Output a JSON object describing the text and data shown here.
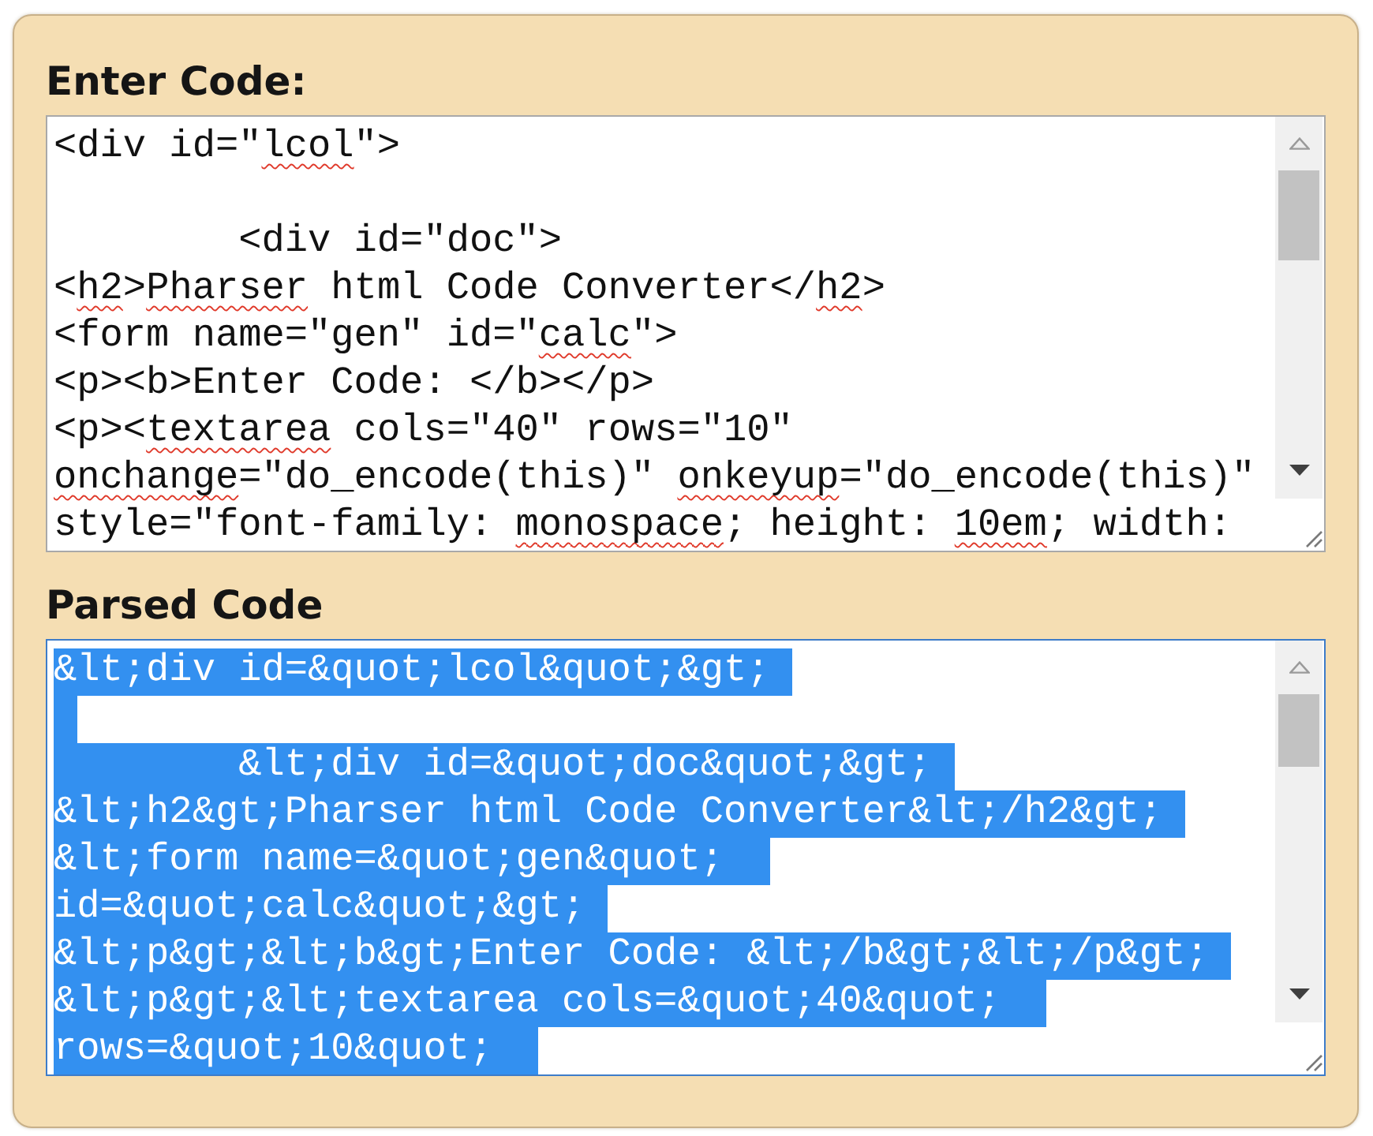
{
  "sections": [
    {
      "label": "Enter Code:",
      "focused": false,
      "lines": [
        {
          "kind": "text",
          "segments": [
            {
              "text": "<div id=\"",
              "misspelled": false
            },
            {
              "text": "lcol",
              "misspelled": true
            },
            {
              "text": "\">",
              "misspelled": false
            }
          ]
        },
        {
          "kind": "blank"
        },
        {
          "kind": "text",
          "segments": [
            {
              "text": "        <div id=\"doc\">",
              "misspelled": false
            }
          ]
        },
        {
          "kind": "text",
          "segments": [
            {
              "text": "<",
              "misspelled": false
            },
            {
              "text": "h2",
              "misspelled": true
            },
            {
              "text": ">",
              "misspelled": false
            },
            {
              "text": "Pharser",
              "misspelled": true
            },
            {
              "text": " html Code Converter</",
              "misspelled": false
            },
            {
              "text": "h2",
              "misspelled": true
            },
            {
              "text": ">",
              "misspelled": false
            }
          ]
        },
        {
          "kind": "text",
          "segments": [
            {
              "text": "<form name=\"gen\" id=\"",
              "misspelled": false
            },
            {
              "text": "calc",
              "misspelled": true
            },
            {
              "text": "\">",
              "misspelled": false
            }
          ]
        },
        {
          "kind": "text",
          "segments": [
            {
              "text": "<p><b>Enter Code: </b></p>",
              "misspelled": false
            }
          ]
        },
        {
          "kind": "text",
          "segments": [
            {
              "text": "<p><",
              "misspelled": false
            },
            {
              "text": "textarea",
              "misspelled": true
            },
            {
              "text": " cols=\"40\" rows=\"10\"",
              "misspelled": false
            }
          ]
        },
        {
          "kind": "text",
          "segments": [
            {
              "text": "onchange",
              "misspelled": true
            },
            {
              "text": "=\"do_encode(this)\" ",
              "misspelled": false
            },
            {
              "text": "onkeyup",
              "misspelled": true
            },
            {
              "text": "=\"do_encode(this)\"",
              "misspelled": false
            }
          ]
        },
        {
          "kind": "text",
          "segments": [
            {
              "text": "style=\"font-family: ",
              "misspelled": false
            },
            {
              "text": "monospace",
              "misspelled": true
            },
            {
              "text": "; height: ",
              "misspelled": false
            },
            {
              "text": "10em",
              "misspelled": true
            },
            {
              "text": "; width:",
              "misspelled": false
            }
          ]
        }
      ]
    },
    {
      "label": "Parsed Code",
      "focused": true,
      "lines": [
        {
          "kind": "text",
          "text": "&lt;div id=&quot;lcol&quot;&gt;",
          "selected": true
        },
        {
          "kind": "blank",
          "selected": true
        },
        {
          "kind": "text",
          "text": "        &lt;div id=&quot;doc&quot;&gt;",
          "selected": true
        },
        {
          "kind": "text",
          "text": "&lt;h2&gt;Pharser html Code Converter&lt;/h2&gt;",
          "selected": true
        },
        {
          "kind": "text",
          "text": "&lt;form name=&quot;gen&quot; ",
          "selected": true
        },
        {
          "kind": "text",
          "text": "id=&quot;calc&quot;&gt;",
          "selected": true
        },
        {
          "kind": "text",
          "text": "&lt;p&gt;&lt;b&gt;Enter Code: &lt;/b&gt;&lt;/p&gt;",
          "selected": true
        },
        {
          "kind": "text",
          "text": "&lt;p&gt;&lt;textarea cols=&quot;40&quot; ",
          "selected": true
        },
        {
          "kind": "text",
          "text": "rows=&quot;10&quot; ",
          "selected": true
        }
      ]
    }
  ]
}
